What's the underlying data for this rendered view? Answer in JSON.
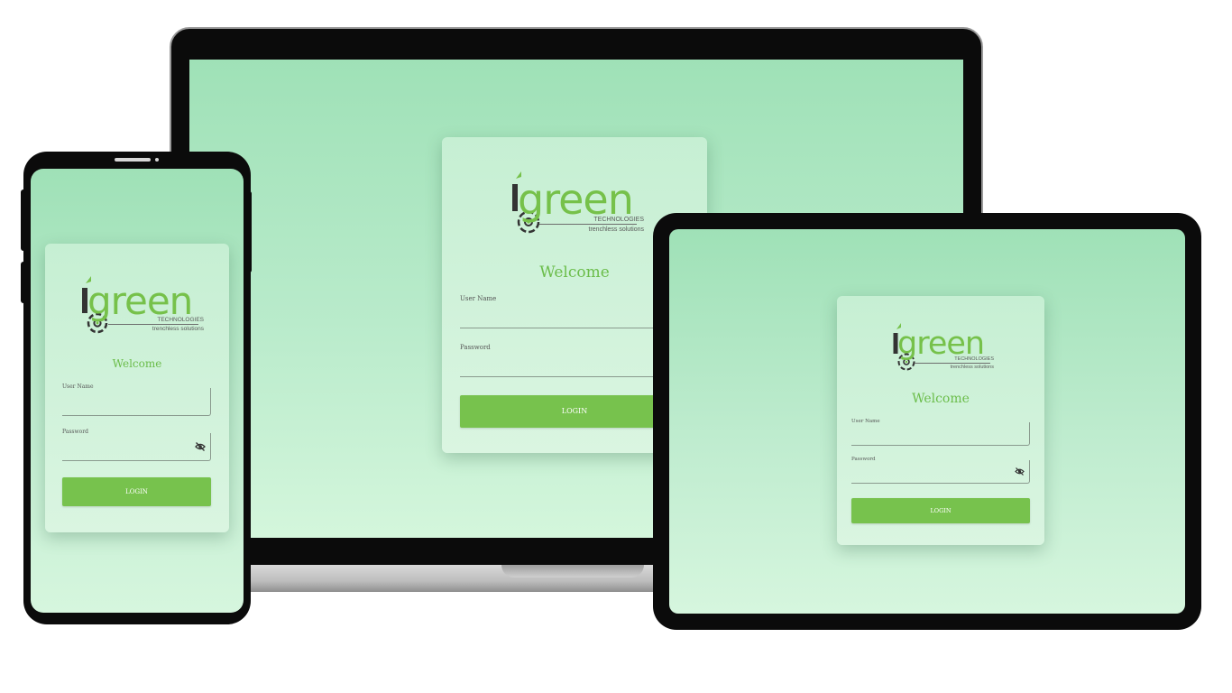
{
  "brand": {
    "wordmark": "green",
    "company": "TECHNOLOGIES",
    "tagline": "trenchless solutions",
    "accent_color": "#77c24d"
  },
  "login": {
    "welcome": "Welcome",
    "username_label": "User Name",
    "password_label": "Password",
    "username_value": "",
    "password_value": "",
    "button_label": "LOGIN",
    "password_toggle_icon": "eye-off-icon"
  },
  "colors": {
    "screen_top": "#9fe1b7",
    "screen_bottom": "#d6f6de",
    "card_bg": "#c6efd3",
    "device_frame": "#0b0b0b"
  }
}
